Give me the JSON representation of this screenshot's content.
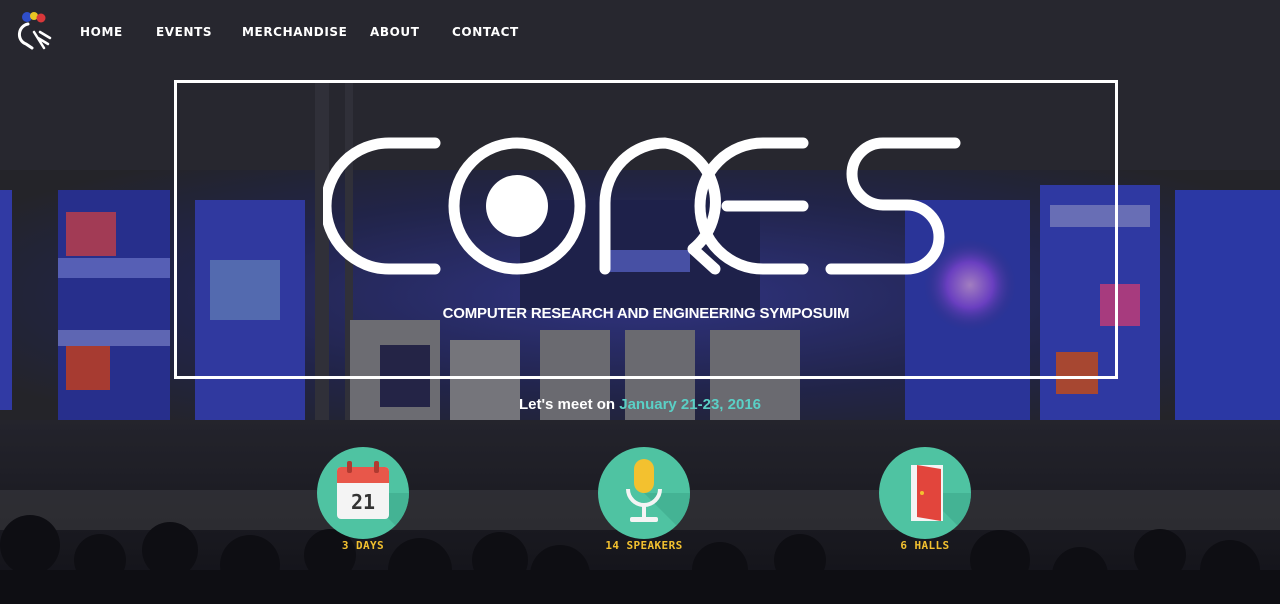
{
  "nav": {
    "items": [
      {
        "label": "HOME"
      },
      {
        "label": "EVENTS"
      },
      {
        "label": "MERCHANDISE"
      },
      {
        "label": "ABOUT"
      },
      {
        "label": "CONTACT"
      }
    ]
  },
  "hero": {
    "subtitle": "COMPUTER RESEARCH AND ENGINEERING SYMPOSUIM",
    "meet_lead": "Let's meet on",
    "meet_date": "January 21-23, 2016"
  },
  "stats": [
    {
      "icon": "calendar-icon",
      "icon_text": "21",
      "label": "3 DAYS"
    },
    {
      "icon": "microphone-icon",
      "label": "14 SPEAKERS"
    },
    {
      "icon": "door-icon",
      "label": "6 HALLS"
    }
  ],
  "colors": {
    "accent_teal": "#5ad0c6",
    "stat_circle": "#4fc3a2",
    "stat_label": "#f3c12f"
  }
}
